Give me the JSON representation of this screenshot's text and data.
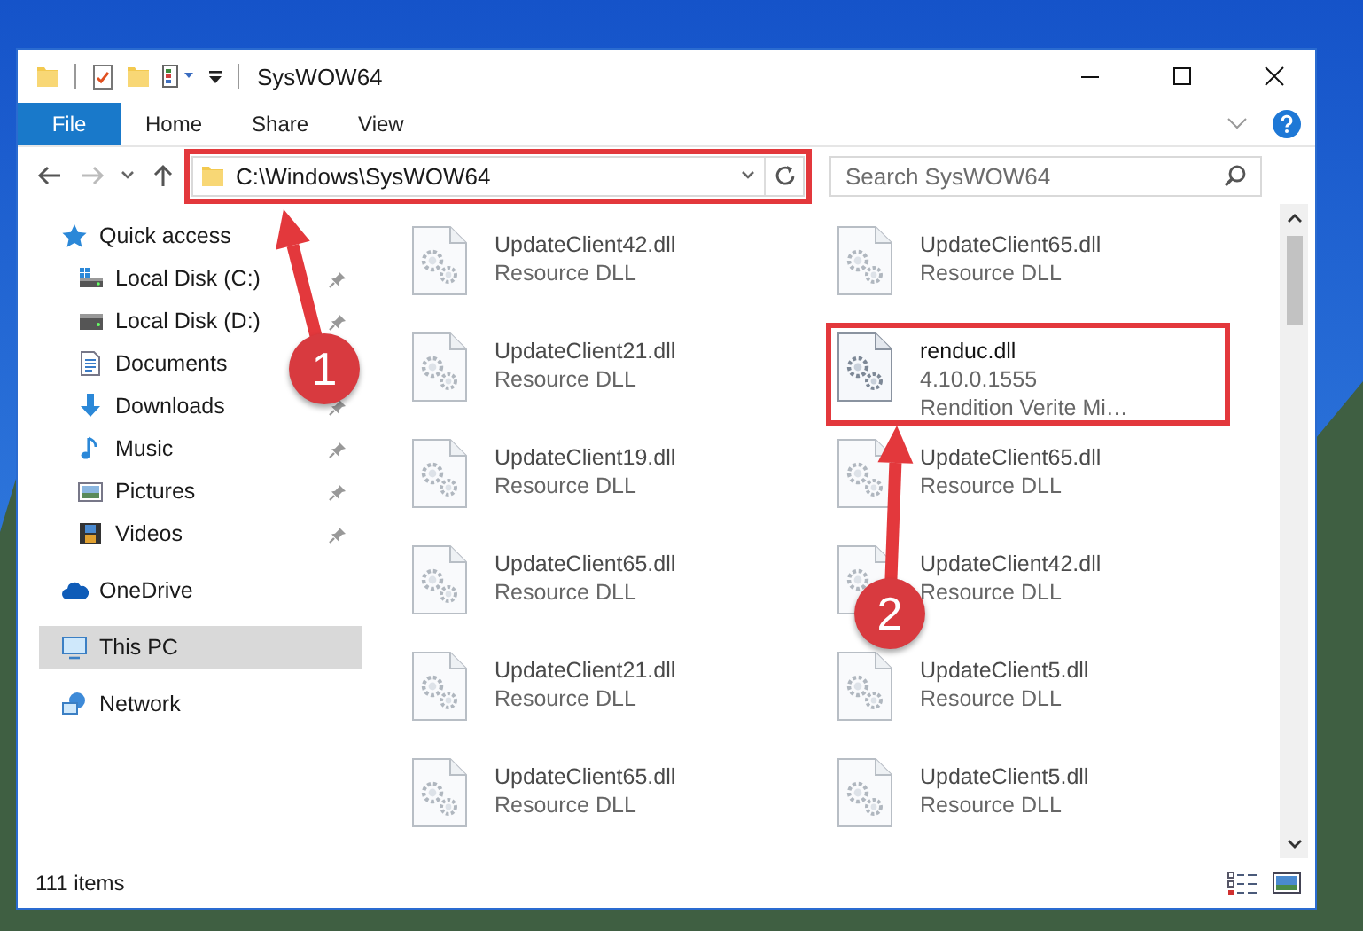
{
  "window": {
    "title": "SysWOW64"
  },
  "ribbon": {
    "tabs": [
      {
        "label": "File",
        "kind": "file"
      },
      {
        "label": "Home",
        "kind": "tab"
      },
      {
        "label": "Share",
        "kind": "tab"
      },
      {
        "label": "View",
        "kind": "tab"
      }
    ]
  },
  "address_bar": {
    "path": "C:\\Windows\\SysWOW64",
    "highlighted": true
  },
  "search": {
    "placeholder": "Search SysWOW64"
  },
  "navigation": [
    {
      "label": "Quick access",
      "kind": "quick-access",
      "selected": false,
      "children": [
        {
          "label": "Local Disk (C:)",
          "kind": "drive-c",
          "pinned": true,
          "selected": false
        },
        {
          "label": "Local Disk (D:)",
          "kind": "drive-d",
          "pinned": true,
          "selected": false
        },
        {
          "label": "Documents",
          "kind": "documents",
          "selected": false
        },
        {
          "label": "Downloads",
          "kind": "downloads",
          "pinned": true,
          "selected": false
        },
        {
          "label": "Music",
          "kind": "music",
          "pinned": true,
          "selected": false
        },
        {
          "label": "Pictures",
          "kind": "pictures",
          "pinned": true,
          "selected": false
        },
        {
          "label": "Videos",
          "kind": "videos",
          "pinned": true,
          "selected": false
        }
      ]
    },
    {
      "label": "OneDrive",
      "kind": "onedrive",
      "selected": false
    },
    {
      "label": "This PC",
      "kind": "this-pc",
      "selected": true
    },
    {
      "label": "Network",
      "kind": "network",
      "selected": false
    }
  ],
  "files": [
    {
      "name": "UpdateClient42.dll",
      "details": [
        "Resource DLL"
      ],
      "highlighted": false
    },
    {
      "name": "UpdateClient65.dll",
      "details": [
        "Resource DLL"
      ],
      "highlighted": false
    },
    {
      "name": "UpdateClient21.dll",
      "details": [
        "Resource DLL"
      ],
      "highlighted": false
    },
    {
      "name": "renduc.dll",
      "details": [
        "4.10.0.1555",
        "Rendition Verite Mi…"
      ],
      "highlighted": true
    },
    {
      "name": "UpdateClient19.dll",
      "details": [
        "Resource DLL"
      ],
      "highlighted": false
    },
    {
      "name": "UpdateClient65.dll",
      "details": [
        "Resource DLL"
      ],
      "highlighted": false
    },
    {
      "name": "UpdateClient65.dll",
      "details": [
        "Resource DLL"
      ],
      "highlighted": false
    },
    {
      "name": "UpdateClient42.dll",
      "details": [
        "Resource DLL"
      ],
      "highlighted": false
    },
    {
      "name": "UpdateClient21.dll",
      "details": [
        "Resource DLL"
      ],
      "highlighted": false
    },
    {
      "name": "UpdateClient5.dll",
      "details": [
        "Resource DLL"
      ],
      "highlighted": false
    },
    {
      "name": "UpdateClient65.dll",
      "details": [
        "Resource DLL"
      ],
      "highlighted": false
    },
    {
      "name": "UpdateClient5.dll",
      "details": [
        "Resource DLL"
      ],
      "highlighted": false
    }
  ],
  "status_bar": {
    "count": "111 items"
  },
  "callouts": [
    {
      "label": "1"
    },
    {
      "label": "2"
    }
  ]
}
